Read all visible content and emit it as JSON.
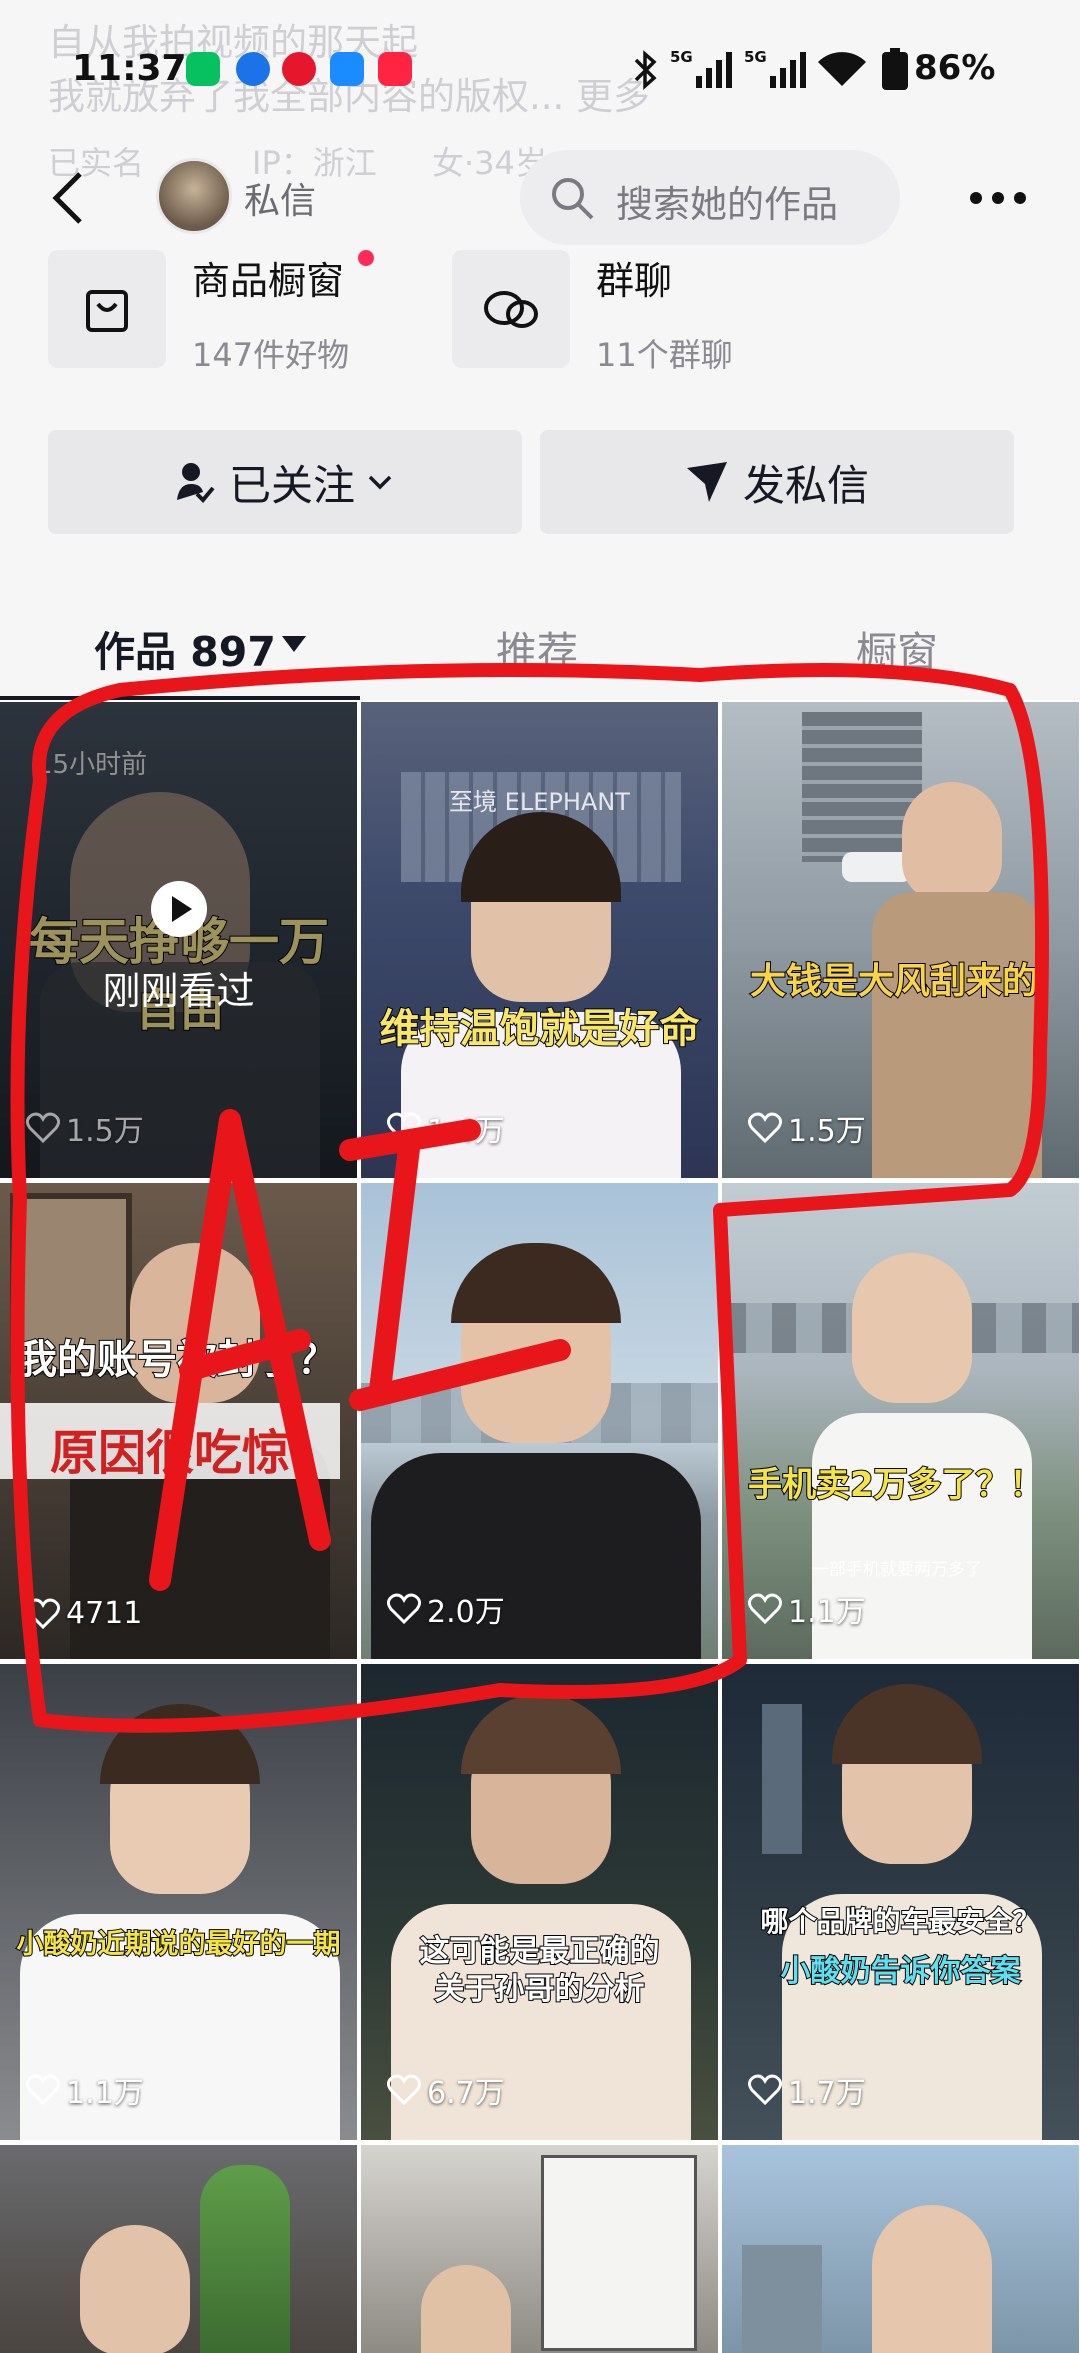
{
  "status_bar": {
    "time": "11:37",
    "battery": "86%",
    "network": "5G"
  },
  "profile_faded": {
    "bio_line1": "自从我拍视频的那天起",
    "bio_line2": "我就放弃了我全部内容的版权... 更多",
    "tag_verified": "已实名",
    "tag_ip": "IP：浙江",
    "tag_gender_age": "女·34岁"
  },
  "header": {
    "dm_label": "私信",
    "search_placeholder": "搜索她的作品"
  },
  "shop_card": {
    "title": "商品橱窗",
    "subtitle": "147件好物"
  },
  "group_card": {
    "title": "群聊",
    "subtitle": "11个群聊"
  },
  "buttons": {
    "following": "已关注",
    "send_dm": "发私信"
  },
  "tabs": {
    "works": "作品 897",
    "recommend": "推荐",
    "showcase": "橱窗"
  },
  "videos": [
    {
      "caption1": "每天挣够一万",
      "caption2": "自由",
      "time_ago": "15小时前",
      "overlay": "刚刚看过",
      "likes": "1.5万"
    },
    {
      "caption1": "维持温饱就是好命",
      "sign": "至境 ELEPHANT",
      "likes": "1.4万"
    },
    {
      "caption1": "大钱是大风刮来的",
      "likes": "1.5万"
    },
    {
      "caption1": "我的账号被封了？",
      "caption2": "原因很吃惊",
      "likes": "4711"
    },
    {
      "caption1": "",
      "likes": "2.0万"
    },
    {
      "caption1": "手机卖2万多了？！",
      "caption2": "一部手机就要两万多了",
      "likes": "1.1万"
    },
    {
      "caption1": "小酸奶近期说的最好的一期",
      "likes": "1.1万"
    },
    {
      "caption1": "这可能是最正确的",
      "caption2": "关于孙哥的分析",
      "likes": "6.7万"
    },
    {
      "caption1": "哪个品牌的车最安全？",
      "caption2": "小酸奶告诉你答案",
      "likes": "1.7万"
    },
    {
      "caption1": "",
      "likes": ""
    },
    {
      "caption1": "",
      "likes": ""
    },
    {
      "caption1": "",
      "likes": ""
    }
  ],
  "annotation": {
    "text": "AI",
    "color": "#e8161b"
  }
}
